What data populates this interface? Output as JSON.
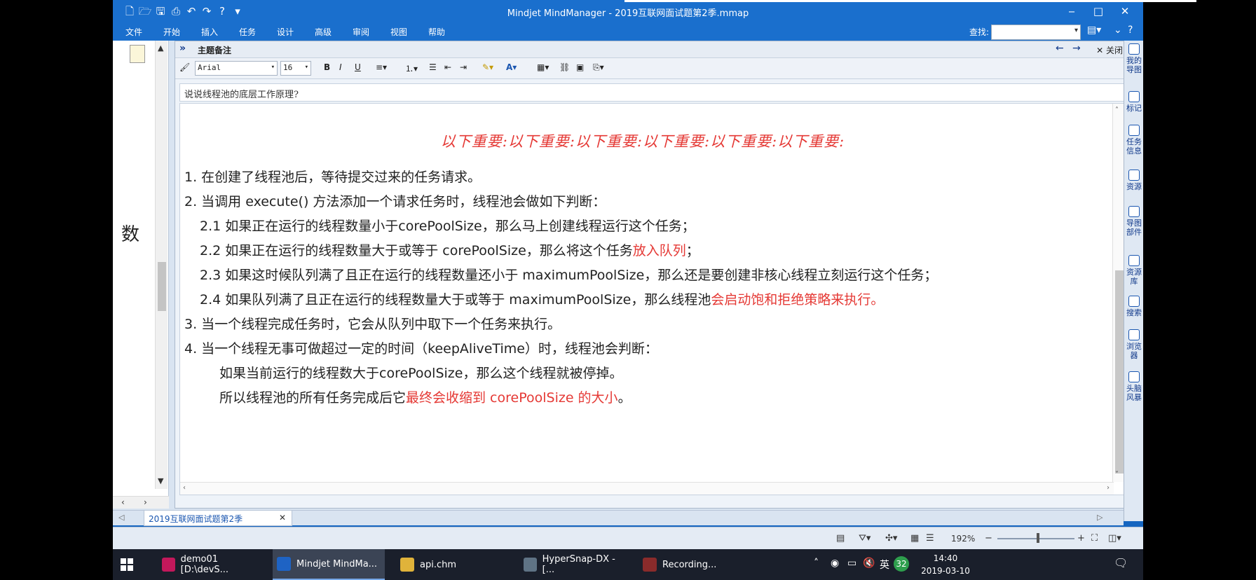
{
  "window": {
    "title": "Mindjet MindManager - 2019互联网面试题第2季.mmap"
  },
  "menu": {
    "items": [
      "文件",
      "开始",
      "插入",
      "任务",
      "设计",
      "高级",
      "审阅",
      "视图",
      "帮助"
    ],
    "search_label": "查找:"
  },
  "left_map": {
    "glyph": "数"
  },
  "notes": {
    "header_title": "主题备注",
    "close_label": "关闭",
    "font_name": "Arial",
    "font_size": "16",
    "subject": "说说线程池的底层工作原理?",
    "important_banner": "以下重要:以下重要:以下重要:以下重要:以下重要:以下重要:",
    "lines": {
      "l1": "1.  在创建了线程池后，等待提交过来的任务请求。",
      "l2": "2.  当调用 execute() 方法添加一个请求任务时，线程池会做如下判断：",
      "l21": "2.1  如果正在运行的线程数量小于corePoolSize，那么马上创建线程运行这个任务；",
      "l22a": "2.2  如果正在运行的线程数量大于或等于 corePoolSize，那么将这个任务",
      "l22b": "放入队列",
      "l22c": "；",
      "l23": "2.3  如果这时候队列满了且正在运行的线程数量还小于 maximumPoolSize，那么还是要创建非核心线程立刻运行这个任务；",
      "l24a": "2.4  如果队列满了且正在运行的线程数量大于或等于 maximumPoolSize，那么线程池",
      "l24b": "会启动饱和拒绝策略来执行。",
      "l3": "3.  当一个线程完成任务时，它会从队列中取下一个任务来执行。",
      "l4": "4.  当一个线程无事可做超过一定的时间（keepAliveTime）时，线程池会判断：",
      "l5": "如果当前运行的线程数大于corePoolSize，那么这个线程就被停掉。",
      "l6a": "所以线程池的所有任务完成后它",
      "l6b": "最终会收缩到 corePoolSize 的大小",
      "l6c": "。"
    }
  },
  "right_panel": {
    "items": [
      "我的导图",
      "标记",
      "任务信息",
      "资源",
      "导图部件",
      "资源库",
      "搜索",
      "浏览器",
      "头脑风暴"
    ]
  },
  "doc_tab": {
    "label": "2019互联网面试题第2季"
  },
  "status": {
    "zoom": "192%"
  },
  "taskbar": {
    "items": [
      "demo01 [D:\\devS...",
      "Mindjet MindMa...",
      "api.chm",
      "HyperSnap-DX - [...",
      "Recording..."
    ],
    "badge": "32",
    "ime": "英",
    "time": "14:40",
    "date": "2019-03-10"
  },
  "colors": {
    "title_blue": "#1a6fcd",
    "accent_red": "#e53935",
    "pane_bg": "#d9e4f1",
    "taskbar": "#1a1f2b"
  }
}
